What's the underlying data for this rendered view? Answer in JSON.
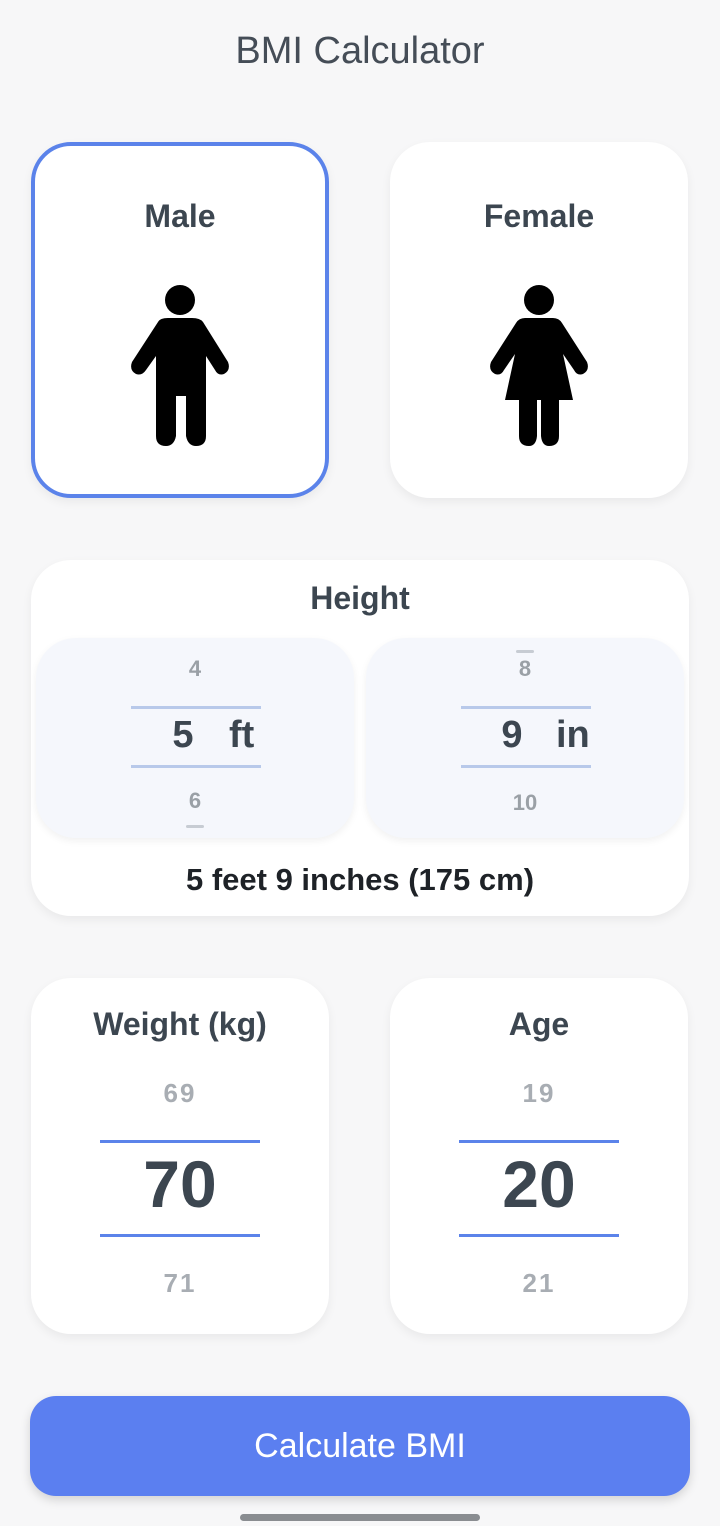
{
  "app": {
    "title": "BMI Calculator"
  },
  "gender": {
    "selected": "male",
    "male": {
      "label": "Male",
      "icon": "male-person-icon"
    },
    "female": {
      "label": "Female",
      "icon": "female-person-icon"
    }
  },
  "height": {
    "title": "Height",
    "feet": {
      "prev": "4",
      "current": "5",
      "next": "6",
      "unit": "ft"
    },
    "inches": {
      "prev": "8",
      "current": "9",
      "next": "10",
      "unit": "in"
    },
    "summary": "5 feet 9 inches (175 cm)"
  },
  "weight": {
    "title": "Weight (kg)",
    "prev": "69",
    "current": "70",
    "next": "71"
  },
  "age": {
    "title": "Age",
    "prev": "19",
    "current": "20",
    "next": "21"
  },
  "actions": {
    "calculate_label": "Calculate BMI"
  },
  "colors": {
    "accent": "#5b83ea",
    "button": "#5b7ff0",
    "background": "#f7f7f8",
    "text": "#3c4650"
  }
}
